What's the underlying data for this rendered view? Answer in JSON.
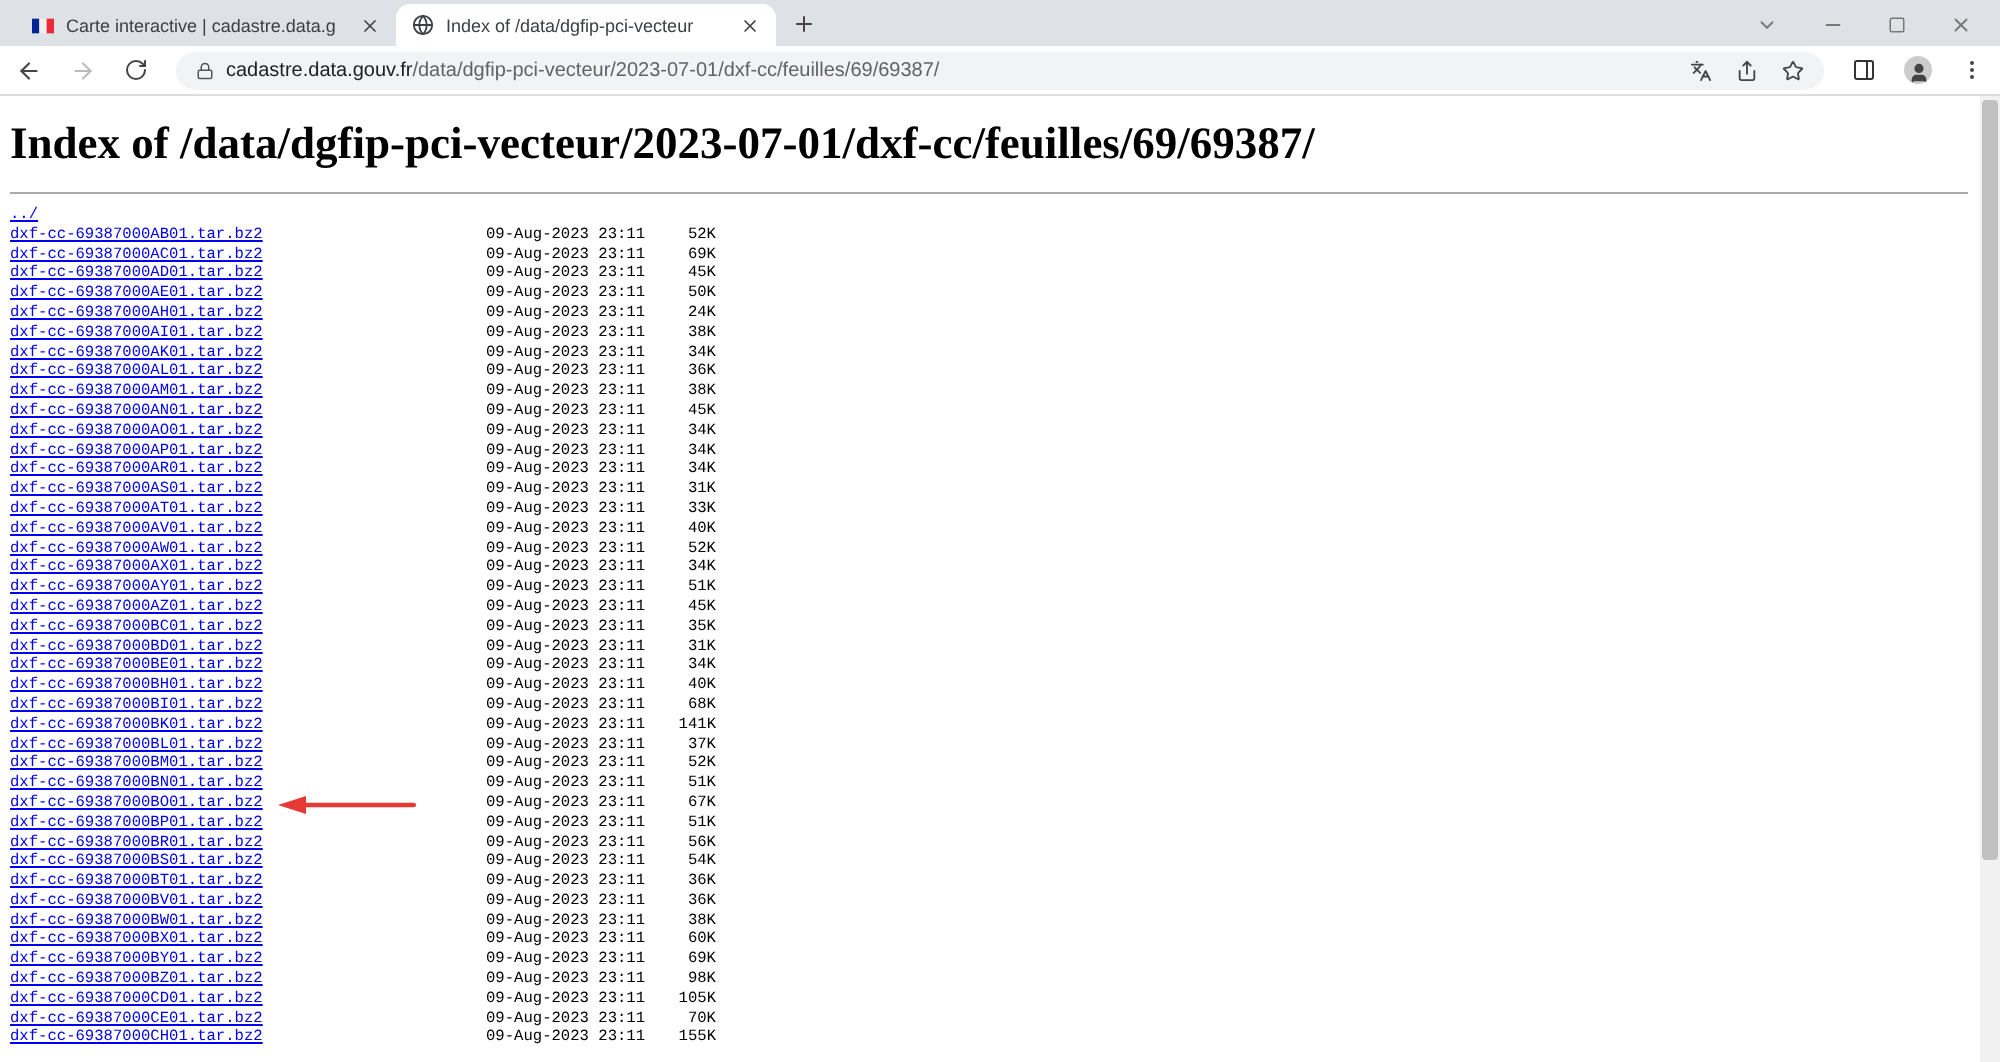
{
  "tabs": [
    {
      "title": "Carte interactive | cadastre.data.g",
      "selected": false
    },
    {
      "title": "Index of /data/dgfip-pci-vecteur",
      "selected": true
    }
  ],
  "address": {
    "host": "cadastre.data.gouv.fr",
    "path": "/data/dgfip-pci-vecteur/2023-07-01/dxf-cc/feuilles/69/69387/"
  },
  "page": {
    "heading": "Index of /data/dgfip-pci-vecteur/2023-07-01/dxf-cc/feuilles/69/69387/",
    "parent_link": "../",
    "rows": [
      {
        "name": "dxf-cc-69387000AB01.tar.bz2",
        "date": "09-Aug-2023 23:11",
        "size": "52K",
        "pointed": false
      },
      {
        "name": "dxf-cc-69387000AC01.tar.bz2",
        "date": "09-Aug-2023 23:11",
        "size": "69K",
        "pointed": false
      },
      {
        "name": "dxf-cc-69387000AD01.tar.bz2",
        "date": "09-Aug-2023 23:11",
        "size": "45K",
        "pointed": false
      },
      {
        "name": "dxf-cc-69387000AE01.tar.bz2",
        "date": "09-Aug-2023 23:11",
        "size": "50K",
        "pointed": false
      },
      {
        "name": "dxf-cc-69387000AH01.tar.bz2",
        "date": "09-Aug-2023 23:11",
        "size": "24K",
        "pointed": false
      },
      {
        "name": "dxf-cc-69387000AI01.tar.bz2",
        "date": "09-Aug-2023 23:11",
        "size": "38K",
        "pointed": false
      },
      {
        "name": "dxf-cc-69387000AK01.tar.bz2",
        "date": "09-Aug-2023 23:11",
        "size": "34K",
        "pointed": false
      },
      {
        "name": "dxf-cc-69387000AL01.tar.bz2",
        "date": "09-Aug-2023 23:11",
        "size": "36K",
        "pointed": false
      },
      {
        "name": "dxf-cc-69387000AM01.tar.bz2",
        "date": "09-Aug-2023 23:11",
        "size": "38K",
        "pointed": false
      },
      {
        "name": "dxf-cc-69387000AN01.tar.bz2",
        "date": "09-Aug-2023 23:11",
        "size": "45K",
        "pointed": false
      },
      {
        "name": "dxf-cc-69387000AO01.tar.bz2",
        "date": "09-Aug-2023 23:11",
        "size": "34K",
        "pointed": false
      },
      {
        "name": "dxf-cc-69387000AP01.tar.bz2",
        "date": "09-Aug-2023 23:11",
        "size": "34K",
        "pointed": false
      },
      {
        "name": "dxf-cc-69387000AR01.tar.bz2",
        "date": "09-Aug-2023 23:11",
        "size": "34K",
        "pointed": false
      },
      {
        "name": "dxf-cc-69387000AS01.tar.bz2",
        "date": "09-Aug-2023 23:11",
        "size": "31K",
        "pointed": false
      },
      {
        "name": "dxf-cc-69387000AT01.tar.bz2",
        "date": "09-Aug-2023 23:11",
        "size": "33K",
        "pointed": false
      },
      {
        "name": "dxf-cc-69387000AV01.tar.bz2",
        "date": "09-Aug-2023 23:11",
        "size": "40K",
        "pointed": false
      },
      {
        "name": "dxf-cc-69387000AW01.tar.bz2",
        "date": "09-Aug-2023 23:11",
        "size": "52K",
        "pointed": false
      },
      {
        "name": "dxf-cc-69387000AX01.tar.bz2",
        "date": "09-Aug-2023 23:11",
        "size": "34K",
        "pointed": false
      },
      {
        "name": "dxf-cc-69387000AY01.tar.bz2",
        "date": "09-Aug-2023 23:11",
        "size": "51K",
        "pointed": false
      },
      {
        "name": "dxf-cc-69387000AZ01.tar.bz2",
        "date": "09-Aug-2023 23:11",
        "size": "45K",
        "pointed": false
      },
      {
        "name": "dxf-cc-69387000BC01.tar.bz2",
        "date": "09-Aug-2023 23:11",
        "size": "35K",
        "pointed": false
      },
      {
        "name": "dxf-cc-69387000BD01.tar.bz2",
        "date": "09-Aug-2023 23:11",
        "size": "31K",
        "pointed": false
      },
      {
        "name": "dxf-cc-69387000BE01.tar.bz2",
        "date": "09-Aug-2023 23:11",
        "size": "34K",
        "pointed": false
      },
      {
        "name": "dxf-cc-69387000BH01.tar.bz2",
        "date": "09-Aug-2023 23:11",
        "size": "40K",
        "pointed": false
      },
      {
        "name": "dxf-cc-69387000BI01.tar.bz2",
        "date": "09-Aug-2023 23:11",
        "size": "68K",
        "pointed": false
      },
      {
        "name": "dxf-cc-69387000BK01.tar.bz2",
        "date": "09-Aug-2023 23:11",
        "size": "141K",
        "pointed": false
      },
      {
        "name": "dxf-cc-69387000BL01.tar.bz2",
        "date": "09-Aug-2023 23:11",
        "size": "37K",
        "pointed": false
      },
      {
        "name": "dxf-cc-69387000BM01.tar.bz2",
        "date": "09-Aug-2023 23:11",
        "size": "52K",
        "pointed": false
      },
      {
        "name": "dxf-cc-69387000BN01.tar.bz2",
        "date": "09-Aug-2023 23:11",
        "size": "51K",
        "pointed": false
      },
      {
        "name": "dxf-cc-69387000BO01.tar.bz2",
        "date": "09-Aug-2023 23:11",
        "size": "67K",
        "pointed": true
      },
      {
        "name": "dxf-cc-69387000BP01.tar.bz2",
        "date": "09-Aug-2023 23:11",
        "size": "51K",
        "pointed": false
      },
      {
        "name": "dxf-cc-69387000BR01.tar.bz2",
        "date": "09-Aug-2023 23:11",
        "size": "56K",
        "pointed": false
      },
      {
        "name": "dxf-cc-69387000BS01.tar.bz2",
        "date": "09-Aug-2023 23:11",
        "size": "54K",
        "pointed": false
      },
      {
        "name": "dxf-cc-69387000BT01.tar.bz2",
        "date": "09-Aug-2023 23:11",
        "size": "36K",
        "pointed": false
      },
      {
        "name": "dxf-cc-69387000BV01.tar.bz2",
        "date": "09-Aug-2023 23:11",
        "size": "36K",
        "pointed": false
      },
      {
        "name": "dxf-cc-69387000BW01.tar.bz2",
        "date": "09-Aug-2023 23:11",
        "size": "38K",
        "pointed": false
      },
      {
        "name": "dxf-cc-69387000BX01.tar.bz2",
        "date": "09-Aug-2023 23:11",
        "size": "60K",
        "pointed": false
      },
      {
        "name": "dxf-cc-69387000BY01.tar.bz2",
        "date": "09-Aug-2023 23:11",
        "size": "69K",
        "pointed": false
      },
      {
        "name": "dxf-cc-69387000BZ01.tar.bz2",
        "date": "09-Aug-2023 23:11",
        "size": "98K",
        "pointed": false
      },
      {
        "name": "dxf-cc-69387000CD01.tar.bz2",
        "date": "09-Aug-2023 23:11",
        "size": "105K",
        "pointed": false
      },
      {
        "name": "dxf-cc-69387000CE01.tar.bz2",
        "date": "09-Aug-2023 23:11",
        "size": "70K",
        "pointed": false
      },
      {
        "name": "dxf-cc-69387000CH01.tar.bz2",
        "date": "09-Aug-2023 23:11",
        "size": "155K",
        "pointed": false
      }
    ]
  }
}
